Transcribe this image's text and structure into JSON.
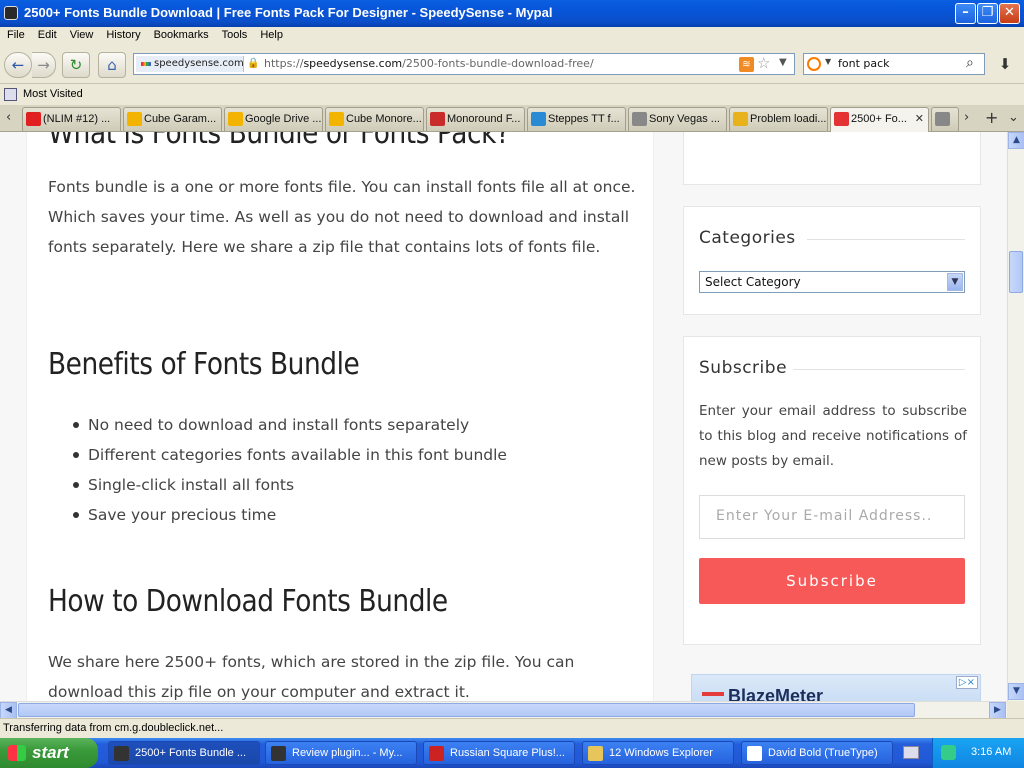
{
  "window": {
    "title": "2500+ Fonts Bundle Download | Free Fonts Pack For Designer - SpeedySense - Mypal"
  },
  "menu": [
    "File",
    "Edit",
    "View",
    "History",
    "Bookmarks",
    "Tools",
    "Help"
  ],
  "urlbar": {
    "site_identity": "speedysense.com",
    "url_prefix": "https://",
    "url_domain": "speedysense.com",
    "url_path": "/2500-fonts-bundle-download-free/"
  },
  "searchbar": {
    "value": "font pack"
  },
  "bookmarks": {
    "most_visited": "Most Visited"
  },
  "tabs": [
    {
      "label": "(NLIM #12) ...",
      "icon": "youtube-icon",
      "color": "#e02020"
    },
    {
      "label": "Cube Garam...",
      "icon": "google-drive-icon",
      "color": "#f2b400"
    },
    {
      "label": "Google Drive ...",
      "icon": "google-drive-icon",
      "color": "#f2b400"
    },
    {
      "label": "Cube Monore...",
      "icon": "google-drive-icon",
      "color": "#f2b400"
    },
    {
      "label": "Monoround F...",
      "icon": "font-site-icon",
      "color": "#c92a2a"
    },
    {
      "label": "Steppes TT f...",
      "icon": "2u-icon",
      "color": "#2a8ad4"
    },
    {
      "label": "Sony Vegas ...",
      "icon": "globe-icon",
      "color": "#888888"
    },
    {
      "label": "Problem loadi...",
      "icon": "warning-icon",
      "color": "#e8b21c"
    },
    {
      "label": "2500+ Fo...",
      "icon": "speedysense-icon",
      "color": "#e33333",
      "active": true
    }
  ],
  "article": {
    "heading_partial": "What is Fonts Bundle or Fonts Pack?",
    "intro": "Fonts bundle is a one or more fonts file. You can install fonts file all at once. Which saves your time. As well as you do not need to download and install fonts separately. Here we share a zip file that contains lots of fonts file.",
    "benefits_heading": "Benefits of Fonts Bundle",
    "benefits": [
      "No need to download and install fonts separately",
      "Different categories fonts available in this font bundle",
      "Single-click install all fonts",
      "Save your precious time"
    ],
    "download_heading": "How to Download Fonts Bundle",
    "download_text": "We share here 2500+ fonts, which are stored in the zip file. You can download this zip file on your computer and extract it."
  },
  "sidebar": {
    "categories_title": "Categories",
    "select_value": "Select Category",
    "subscribe_title": "Subscribe",
    "subscribe_text": "Enter your email address to subscribe to this blog and receive notifications of new posts by email.",
    "email_placeholder": "Enter Your E-mail Address..",
    "subscribe_button": "Subscribe",
    "ad_text": "BlazeMeter",
    "ad_choice": "▷×"
  },
  "status": {
    "text": "Transferring data from cm.g.doubleclick.net..."
  },
  "taskbar": {
    "start": "start",
    "tasks": [
      {
        "label": "2500+ Fonts Bundle ...",
        "color": "#333333",
        "active": true
      },
      {
        "label": "Review plugin... - My...",
        "color": "#333333"
      },
      {
        "label": "Russian Square Plus!...",
        "color": "#cc2222"
      },
      {
        "label": "12 Windows Explorer",
        "color": "#e8c55a"
      },
      {
        "label": "David Bold (TrueType)",
        "color": "#ffffff"
      }
    ],
    "clock": "3:16 AM"
  },
  "colors": {
    "subscribe_button": "#f75959",
    "titlebar": "#0a55d8",
    "taskbar": "#245edb"
  }
}
